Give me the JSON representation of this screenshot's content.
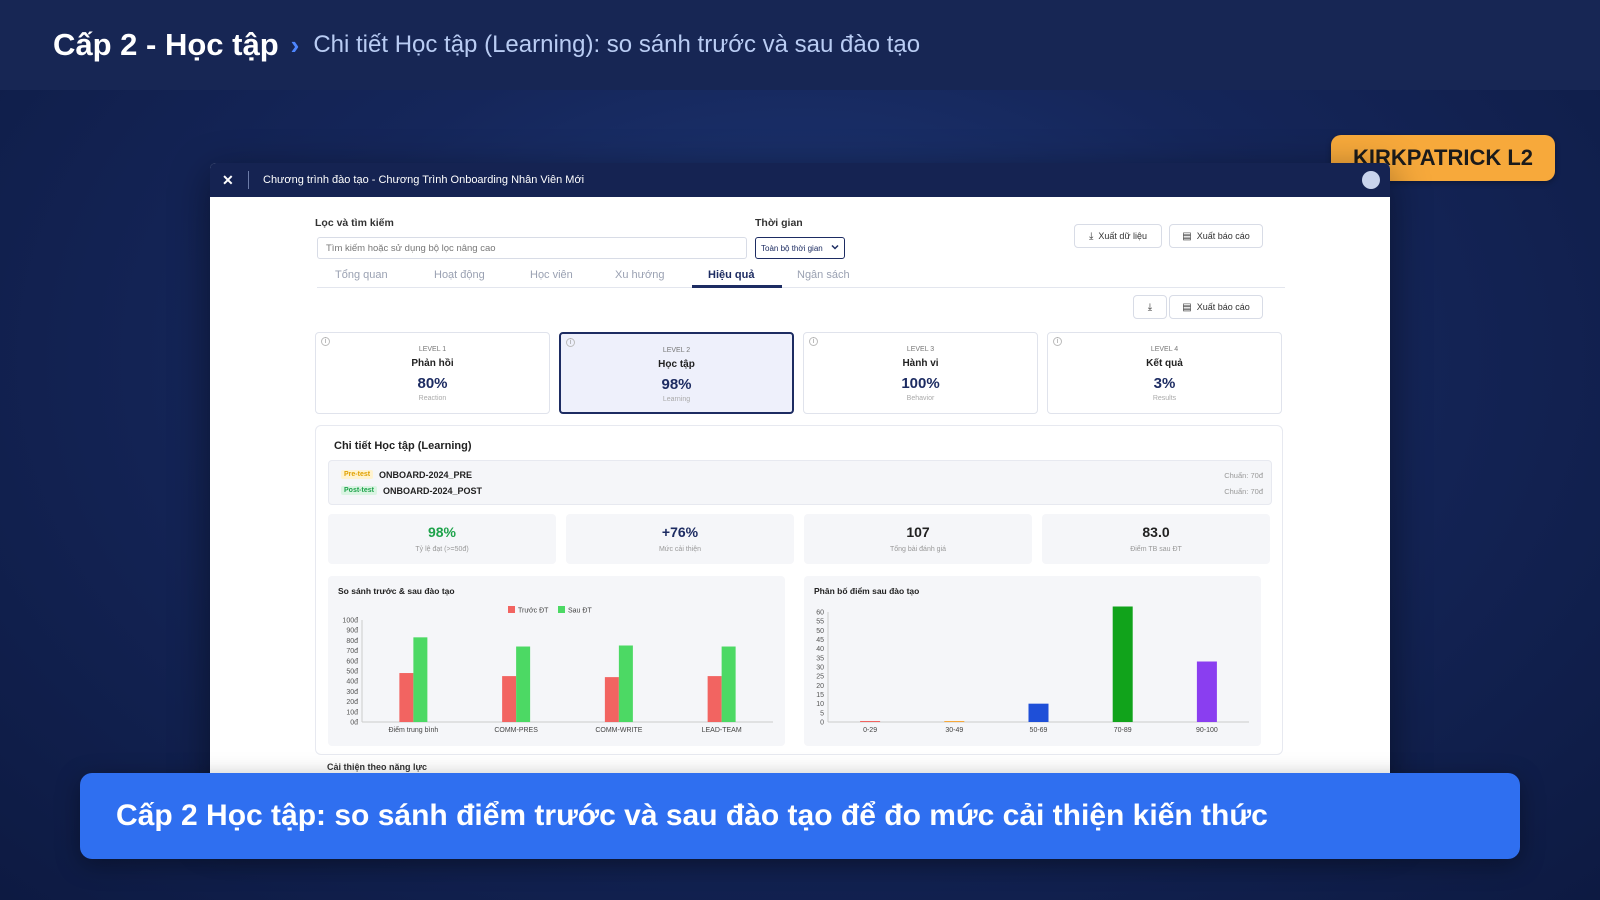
{
  "header": {
    "title": "Cấp 2 - Học tập",
    "separator": "›",
    "subtitle": "Chi tiết Học tập (Learning): so sánh trước và sau đào tạo"
  },
  "badge": "KIRKPATRICK L2",
  "window": {
    "close_icon": "✕",
    "title": "Chương trình đào tạo - Chương Trình Onboarding Nhân Viên Mới"
  },
  "filters": {
    "search_label": "Lọc và tìm kiếm",
    "search_placeholder": "Tìm kiếm hoặc sử dụng bộ lọc nâng cao",
    "time_label": "Thời gian",
    "time_value": "Toàn bộ thời gian",
    "export_data": "Xuất dữ liệu",
    "export_report": "Xuất báo cáo"
  },
  "tabs": [
    "Tổng quan",
    "Hoạt động",
    "Học viên",
    "Xu hướng",
    "Hiệu quả",
    "Ngân sách"
  ],
  "active_tab": "Hiệu quả",
  "secondary_export": "Xuất báo cáo",
  "levels": [
    {
      "level": "LEVEL 1",
      "title": "Phản hồi",
      "value": "80%",
      "sub": "Reaction"
    },
    {
      "level": "LEVEL 2",
      "title": "Học tập",
      "value": "98%",
      "sub": "Learning"
    },
    {
      "level": "LEVEL 3",
      "title": "Hành vi",
      "value": "100%",
      "sub": "Behavior"
    },
    {
      "level": "LEVEL 4",
      "title": "Kết quả",
      "value": "3%",
      "sub": "Results"
    }
  ],
  "detail": {
    "title": "Chi tiết Học tập (Learning)",
    "pre_tag": "Pre-test",
    "pre_code": "ONBOARD-2024_PRE",
    "pre_std": "Chuẩn: 70đ",
    "post_tag": "Post-test",
    "post_code": "ONBOARD-2024_POST",
    "post_std": "Chuẩn: 70đ"
  },
  "stats": [
    {
      "value": "98%",
      "label": "Tỷ lệ đạt (>=50đ)",
      "color": "#1ea34b"
    },
    {
      "value": "+76%",
      "label": "Mức cải thiện",
      "color": "#1d2c62"
    },
    {
      "value": "107",
      "label": "Tổng bài đánh giá",
      "color": "#222222"
    },
    {
      "value": "83.0",
      "label": "Điểm TB sau ĐT",
      "color": "#222222"
    }
  ],
  "chart_data": [
    {
      "type": "bar",
      "title": "So sánh trước & sau đào tạo",
      "categories": [
        "Điểm trung bình",
        "COMM-PRES",
        "COMM-WRITE",
        "LEAD-TEAM"
      ],
      "series": [
        {
          "name": "Trước ĐT",
          "color": "#f26461",
          "values": [
            48,
            45,
            44,
            45
          ]
        },
        {
          "name": "Sau ĐT",
          "color": "#4cd964",
          "values": [
            83,
            74,
            75,
            74
          ]
        }
      ],
      "ylim": [
        0,
        100
      ],
      "yticks": [
        "0đ",
        "10đ",
        "20đ",
        "30đ",
        "40đ",
        "50đ",
        "60đ",
        "70đ",
        "80đ",
        "90đ",
        "100đ"
      ],
      "legend": "top"
    },
    {
      "type": "bar",
      "title": "Phân bố điểm sau đào tạo",
      "categories": [
        "0-29",
        "30-49",
        "50-69",
        "70-89",
        "90-100"
      ],
      "values": [
        0,
        0,
        10,
        63,
        33
      ],
      "colors": [
        "#f26461",
        "#f7a93b",
        "#1e4fd8",
        "#11a31b",
        "#8a3ef0"
      ],
      "ylim": [
        0,
        60
      ],
      "yticks": [
        "0",
        "5",
        "10",
        "15",
        "20",
        "25",
        "30",
        "35",
        "40",
        "45",
        "50",
        "55",
        "60"
      ]
    }
  ],
  "next_section": "Cải thiện theo năng lực",
  "caption": "Cấp 2 Học tập: so sánh điểm trước và sau đào tạo để đo mức cải thiện kiến thức"
}
